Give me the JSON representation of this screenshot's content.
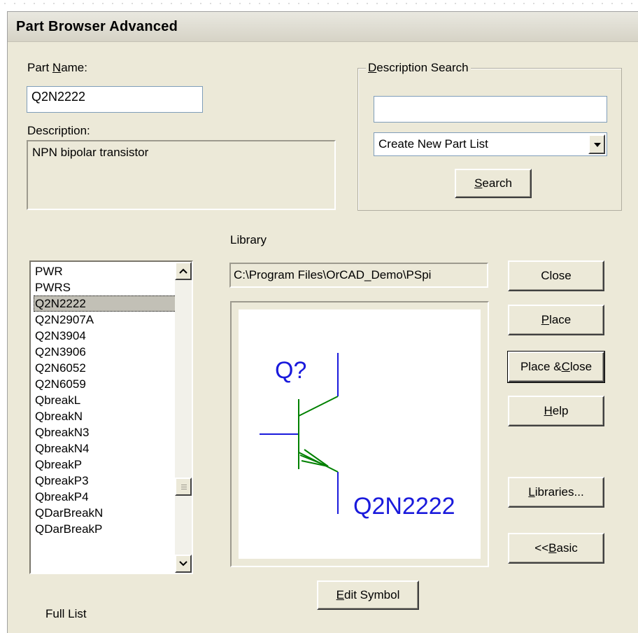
{
  "window": {
    "title": "Part Browser Advanced"
  },
  "part_name": {
    "label": "Part Name:",
    "value": "Q2N2222"
  },
  "description": {
    "label": "Description:",
    "value": "NPN bipolar transistor"
  },
  "description_search": {
    "group_label": "Description Search",
    "input_value": "",
    "dropdown_value": "Create New Part List",
    "search_button": "Search"
  },
  "library": {
    "label": "Library",
    "path": "C:\\Program Files\\OrCAD_Demo\\PSpi"
  },
  "part_list": {
    "items": [
      "PWR",
      "PWRS",
      "Q2N2222",
      "Q2N2907A",
      "Q2N3904",
      "Q2N3906",
      "Q2N6052",
      "Q2N6059",
      "QbreakL",
      "QbreakN",
      "QbreakN3",
      "QbreakN4",
      "QbreakP",
      "QbreakP3",
      "QbreakP4",
      "QDarBreakN",
      "QDarBreakP"
    ],
    "selected": "Q2N2222",
    "footer": "Full List"
  },
  "preview": {
    "ref": "Q?",
    "value": "Q2N2222",
    "line_color": "#008000",
    "text_color": "#1a1adc"
  },
  "buttons": {
    "close": "Close",
    "place": "Place",
    "place_close": "Place & Close",
    "help": "Help",
    "libraries": "Libraries...",
    "basic": "<< Basic",
    "edit_symbol": "Edit Symbol"
  }
}
